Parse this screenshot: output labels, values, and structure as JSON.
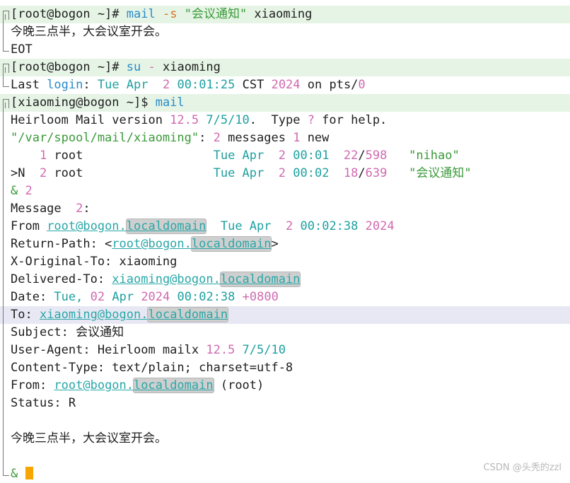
{
  "colors": {
    "accent_blue": "#2a8bc7",
    "string_green": "#3a9a3a",
    "number_pink": "#d06ab0",
    "link_teal": "#2aa7a7",
    "cursor": "#f7a500",
    "prompt_highlight": "#e6f4e6",
    "current_line": "#e8e8f4"
  },
  "lines": [
    {
      "segs": [
        {
          "t": "[root@bogon ~]# "
        },
        {
          "t": "mail",
          "c": "c-blue"
        },
        {
          "t": " "
        },
        {
          "t": "-s",
          "c": "c-orange"
        },
        {
          "t": " "
        },
        {
          "t": "\"会议通知\"",
          "c": "c-green"
        },
        {
          "t": " xiaoming"
        }
      ]
    },
    {
      "segs": [
        {
          "t": "今晚三点半，大会议室开会。"
        }
      ]
    },
    {
      "segs": [
        {
          "t": "EOT"
        }
      ]
    },
    {
      "segs": [
        {
          "t": "[root@bogon ~]# "
        },
        {
          "t": "su",
          "c": "c-blue"
        },
        {
          "t": " "
        },
        {
          "t": "-",
          "c": "c-pink"
        },
        {
          "t": " xiaoming"
        }
      ]
    },
    {
      "segs": [
        {
          "t": "Last "
        },
        {
          "t": "login",
          "c": "c-blue"
        },
        {
          "t": ": "
        },
        {
          "t": "Tue Apr",
          "c": "c-teal"
        },
        {
          "t": "  "
        },
        {
          "t": "2",
          "c": "c-pink"
        },
        {
          "t": " "
        },
        {
          "t": "00:01:25",
          "c": "c-teal"
        },
        {
          "t": " CST "
        },
        {
          "t": "2024",
          "c": "c-pink"
        },
        {
          "t": " on pts/"
        },
        {
          "t": "0",
          "c": "c-pink"
        }
      ]
    },
    {
      "segs": [
        {
          "t": "[xiaoming@bogon ~]$ "
        },
        {
          "t": "mail",
          "c": "c-blue"
        }
      ]
    },
    {
      "segs": [
        {
          "t": "Heirloom Mail version "
        },
        {
          "t": "12.5",
          "c": "c-pink"
        },
        {
          "t": " "
        },
        {
          "t": "7/5/10",
          "c": "c-teal"
        },
        {
          "t": ".  Type "
        },
        {
          "t": "?",
          "c": "c-pink"
        },
        {
          "t": " for help."
        }
      ]
    },
    {
      "segs": [
        {
          "t": "\"/var/spool/mail/xiaoming\"",
          "c": "c-green"
        },
        {
          "t": ": "
        },
        {
          "t": "2",
          "c": "c-pink"
        },
        {
          "t": " messages "
        },
        {
          "t": "1",
          "c": "c-pink"
        },
        {
          "t": " new"
        }
      ]
    },
    {
      "segs": [
        {
          "t": "    "
        },
        {
          "t": "1",
          "c": "c-pink"
        },
        {
          "t": " root                  "
        },
        {
          "t": "Tue Apr",
          "c": "c-teal"
        },
        {
          "t": "  "
        },
        {
          "t": "2",
          "c": "c-pink"
        },
        {
          "t": " "
        },
        {
          "t": "00:01",
          "c": "c-teal"
        },
        {
          "t": "  "
        },
        {
          "t": "22",
          "c": "c-pink"
        },
        {
          "t": "/"
        },
        {
          "t": "598",
          "c": "c-pink"
        },
        {
          "t": "   "
        },
        {
          "t": "\"nihao\"",
          "c": "c-green"
        }
      ]
    },
    {
      "segs": [
        {
          "t": ">N  "
        },
        {
          "t": "2",
          "c": "c-pink"
        },
        {
          "t": " root                  "
        },
        {
          "t": "Tue Apr",
          "c": "c-teal"
        },
        {
          "t": "  "
        },
        {
          "t": "2",
          "c": "c-pink"
        },
        {
          "t": " "
        },
        {
          "t": "00:02",
          "c": "c-teal"
        },
        {
          "t": "  "
        },
        {
          "t": "18",
          "c": "c-pink"
        },
        {
          "t": "/"
        },
        {
          "t": "639",
          "c": "c-pink"
        },
        {
          "t": "   "
        },
        {
          "t": "\"会议通知\"",
          "c": "c-green"
        }
      ]
    },
    {
      "segs": [
        {
          "t": "&",
          "c": "c-green"
        },
        {
          "t": " "
        },
        {
          "t": "2",
          "c": "c-pink"
        }
      ]
    },
    {
      "segs": [
        {
          "t": "Message  "
        },
        {
          "t": "2",
          "c": "c-pink"
        },
        {
          "t": ":"
        }
      ]
    },
    {
      "segs": [
        {
          "t": "From "
        },
        {
          "t": "root@bogon.",
          "c": "link"
        },
        {
          "t": "localdomain",
          "c": "link hint"
        },
        {
          "t": "  "
        },
        {
          "t": "Tue Apr",
          "c": "c-teal"
        },
        {
          "t": "  "
        },
        {
          "t": "2",
          "c": "c-pink"
        },
        {
          "t": " "
        },
        {
          "t": "00:02:38",
          "c": "c-teal"
        },
        {
          "t": " "
        },
        {
          "t": "2024",
          "c": "c-pink"
        }
      ]
    },
    {
      "segs": [
        {
          "t": "Return-Path: <"
        },
        {
          "t": "root@bogon.",
          "c": "link"
        },
        {
          "t": "localdomain",
          "c": "link hint"
        },
        {
          "t": ">"
        }
      ]
    },
    {
      "segs": [
        {
          "t": "X-Original-To: xiaoming"
        }
      ]
    },
    {
      "segs": [
        {
          "t": "Delivered-To: "
        },
        {
          "t": "xiaoming@bogon.",
          "c": "link"
        },
        {
          "t": "localdomain",
          "c": "link hint"
        }
      ]
    },
    {
      "segs": [
        {
          "t": "Date: "
        },
        {
          "t": "Tue, ",
          "c": "c-teal"
        },
        {
          "t": "02",
          "c": "c-pink"
        },
        {
          "t": " "
        },
        {
          "t": "Apr",
          "c": "c-teal"
        },
        {
          "t": " "
        },
        {
          "t": "2024",
          "c": "c-pink"
        },
        {
          "t": " "
        },
        {
          "t": "00:02:38",
          "c": "c-teal"
        },
        {
          "t": " "
        },
        {
          "t": "+0800",
          "c": "c-pink"
        }
      ]
    },
    {
      "segs": [
        {
          "t": "To: "
        },
        {
          "t": "xiaoming@bogon.",
          "c": "link"
        },
        {
          "t": "localdomain",
          "c": "link hint"
        }
      ]
    },
    {
      "segs": [
        {
          "t": "Subject: 会议通知"
        }
      ]
    },
    {
      "segs": [
        {
          "t": "User-Agent: Heirloom mailx "
        },
        {
          "t": "12.5",
          "c": "c-pink"
        },
        {
          "t": " "
        },
        {
          "t": "7/5/10",
          "c": "c-teal"
        }
      ]
    },
    {
      "segs": [
        {
          "t": "Content-Type: text/plain; charset=utf-8"
        }
      ]
    },
    {
      "segs": [
        {
          "t": "From: "
        },
        {
          "t": "root@bogon.",
          "c": "link"
        },
        {
          "t": "localdomain",
          "c": "link hint"
        },
        {
          "t": " (root)"
        }
      ]
    },
    {
      "segs": [
        {
          "t": "Status: R"
        }
      ]
    },
    {
      "segs": []
    },
    {
      "segs": [
        {
          "t": "今晚三点半，大会议室开会。"
        }
      ]
    },
    {
      "segs": []
    },
    {
      "segs": [
        {
          "t": "&",
          "c": "c-green"
        },
        {
          "t": " "
        }
      ],
      "cursor": true
    }
  ],
  "watermark": "CSDN @头秃的zzl"
}
